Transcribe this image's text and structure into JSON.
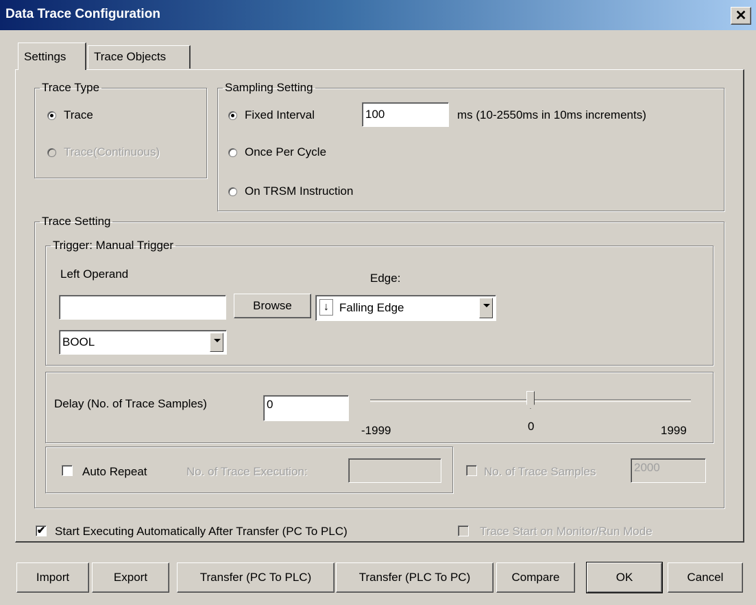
{
  "window": {
    "title": "Data Trace Configuration",
    "close_glyph": "✕"
  },
  "tabs": [
    {
      "label": "Settings",
      "active": true
    },
    {
      "label": "Trace Objects",
      "active": false
    }
  ],
  "trace_type": {
    "legend": "Trace Type",
    "options": [
      {
        "label": "Trace",
        "selected": true,
        "enabled": true
      },
      {
        "label": "Trace(Continuous)",
        "selected": false,
        "enabled": false
      }
    ]
  },
  "sampling": {
    "legend": "Sampling Setting",
    "fixed_interval_label": "Fixed Interval",
    "interval_value": "100",
    "interval_hint": "ms (10-2550ms in 10ms increments)",
    "once_per_cycle_label": "Once Per Cycle",
    "on_trsm_label": "On TRSM Instruction",
    "selected": "Fixed Interval"
  },
  "trace_setting": {
    "legend": "Trace Setting",
    "trigger": {
      "legend": "Trigger: Manual Trigger",
      "left_operand_label": "Left Operand",
      "left_operand_value": "",
      "browse_label": "Browse",
      "edge_label": "Edge:",
      "edge_icon": "↓",
      "edge_value": "Falling Edge",
      "type_value": "BOOL"
    },
    "delay": {
      "label": "Delay (No. of Trace Samples)",
      "value": "0",
      "slider_min": "-1999",
      "slider_mid": "0",
      "slider_max": "1999",
      "slider_fraction": 0.5
    },
    "auto_repeat": {
      "label": "Auto Repeat",
      "checked": false,
      "executions_label": "No. of Trace Execution:",
      "executions_value": ""
    },
    "samples": {
      "label": "No. of Trace Samples",
      "checked": false,
      "value": "2000"
    }
  },
  "start_auto": {
    "label": "Start Executing Automatically After Transfer (PC To PLC)",
    "checked": true,
    "check_glyph": "✔"
  },
  "trace_start_monitor": {
    "label": "Trace Start on Monitor/Run Mode",
    "checked": false
  },
  "buttons": {
    "import": "Import",
    "export": "Export",
    "transfer_pc_plc": "Transfer (PC To PLC)",
    "transfer_plc_pc": "Transfer (PLC To PC)",
    "compare": "Compare",
    "ok": "OK",
    "cancel": "Cancel"
  }
}
